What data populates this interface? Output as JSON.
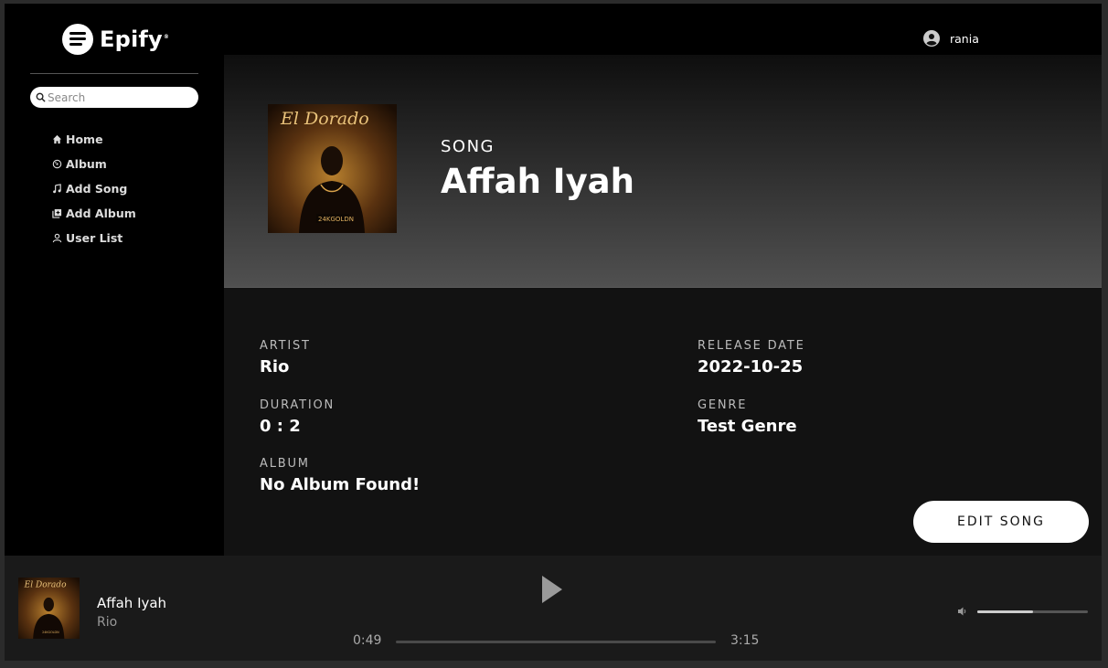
{
  "app": {
    "brand": "Epify",
    "brand_mark": "®"
  },
  "sidebar": {
    "search_placeholder": "Search",
    "items": [
      {
        "label": "Home",
        "icon": "home-icon"
      },
      {
        "label": "Album",
        "icon": "disc-icon"
      },
      {
        "label": "Add Song",
        "icon": "music-note-icon"
      },
      {
        "label": "Add Album",
        "icon": "add-album-icon"
      },
      {
        "label": "User List",
        "icon": "user-icon"
      }
    ]
  },
  "user": {
    "name": "rania",
    "icon": "account-circle-icon"
  },
  "song": {
    "kind": "SONG",
    "title": "Affah Iyah",
    "cover_icon": "album-cover-image"
  },
  "details": {
    "artist_label": "ARTIST",
    "artist": "Rio",
    "duration_label": "DURATION",
    "duration": "0 : 2",
    "album_label": "ALBUM",
    "album": "No Album Found!",
    "release_label": "RELEASE DATE",
    "release": "2022-10-25",
    "genre_label": "GENRE",
    "genre": "Test Genre",
    "edit_label": "EDIT SONG"
  },
  "player": {
    "title": "Affah Iyah",
    "artist": "Rio",
    "current_time": "0:49",
    "total_time": "3:15",
    "progress_fraction": 0,
    "volume_fraction": 0.5
  },
  "colors": {
    "accent": "#ffffff",
    "background": "#121212",
    "sidebar": "#000000"
  }
}
